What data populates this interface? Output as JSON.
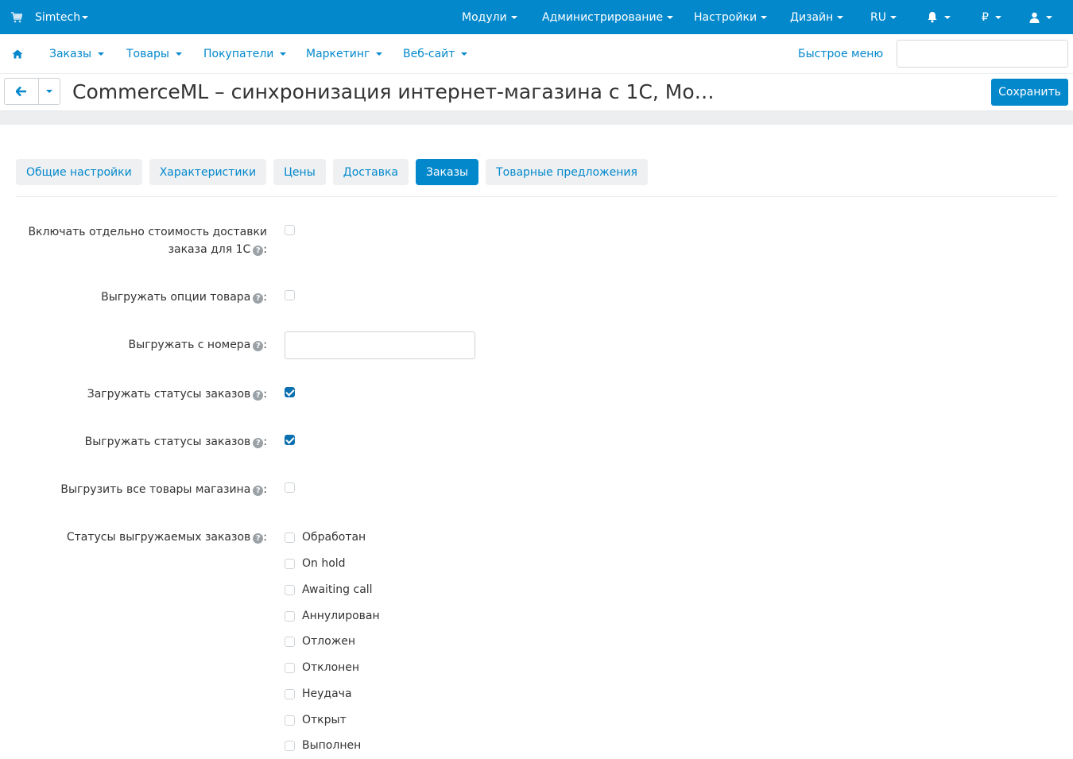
{
  "topbar": {
    "brand": "Simtech",
    "modules": "Модули",
    "administration": "Администрирование",
    "settings": "Настройки",
    "design": "Дизайн",
    "language": "RU",
    "currency": "₽"
  },
  "nav": {
    "orders": "Заказы",
    "products": "Товары",
    "customers": "Покупатели",
    "marketing": "Маркетинг",
    "website": "Веб-сайт",
    "quick_menu": "Быстрое меню",
    "search_value": ""
  },
  "header": {
    "title": "CommerceML – синхронизация интернет-магазина с 1С, Мо…",
    "save_label": "Сохранить"
  },
  "tabs": [
    {
      "label": "Общие настройки",
      "active": false
    },
    {
      "label": "Характеристики",
      "active": false
    },
    {
      "label": "Цены",
      "active": false
    },
    {
      "label": "Доставка",
      "active": false
    },
    {
      "label": "Заказы",
      "active": true
    },
    {
      "label": "Товарные предложения",
      "active": false
    }
  ],
  "form": {
    "delivery_cost_line1": "Включать отдельно стоимость доставки",
    "delivery_cost_line2": "заказа для 1С",
    "delivery_cost_checked": false,
    "export_options": "Выгружать опции товара",
    "export_options_checked": false,
    "export_from_number": "Выгружать с номера",
    "export_from_number_value": "",
    "import_statuses": "Загружать статусы заказов",
    "import_statuses_checked": true,
    "export_statuses": "Выгружать статусы заказов",
    "export_statuses_checked": true,
    "export_all_products": "Выгрузить все товары магазина",
    "export_all_products_checked": false,
    "statuses_label": "Статусы выгружаемых заказов",
    "colon": ":",
    "statuses": [
      {
        "label": "Обработан",
        "checked": false
      },
      {
        "label": "On hold",
        "checked": false
      },
      {
        "label": "Awaiting call",
        "checked": false
      },
      {
        "label": "Аннулирован",
        "checked": false
      },
      {
        "label": "Отложен",
        "checked": false
      },
      {
        "label": "Отклонен",
        "checked": false
      },
      {
        "label": "Неудача",
        "checked": false
      },
      {
        "label": "Открыт",
        "checked": false
      },
      {
        "label": "Выполнен",
        "checked": false
      }
    ]
  },
  "colors": {
    "primary": "#0388cc",
    "checked": "#0a70b0"
  }
}
